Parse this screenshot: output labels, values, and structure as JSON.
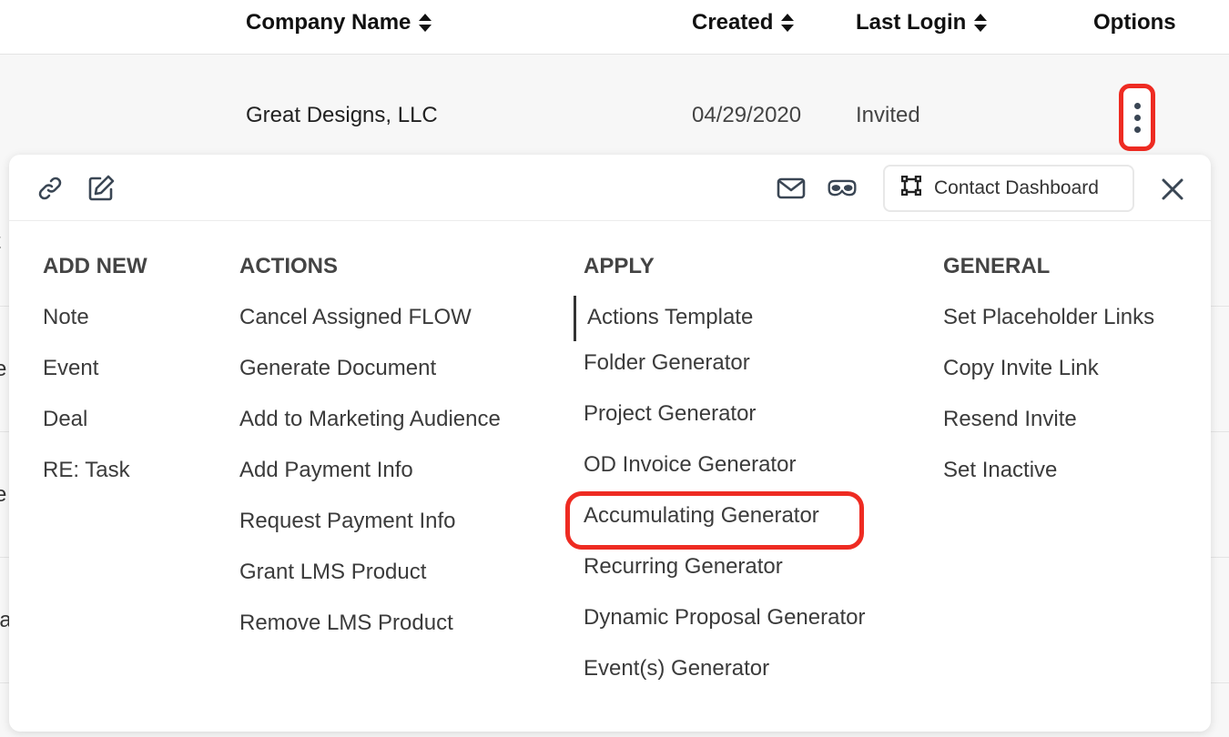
{
  "table": {
    "columns": [
      {
        "label": "Company Name"
      },
      {
        "label": "Created"
      },
      {
        "label": "Last Login"
      },
      {
        "label": "Options"
      }
    ],
    "row": {
      "company": "Great Designs, LLC",
      "created": "04/29/2020",
      "last_login": "Invited"
    }
  },
  "clipped_edge_chars": [
    "t",
    "e",
    "e",
    "la"
  ],
  "toolbar": {
    "contact_dashboard_label": "Contact Dashboard"
  },
  "menu": {
    "add_new": {
      "heading": "ADD NEW",
      "items": [
        "Note",
        "Event",
        "Deal",
        "RE: Task"
      ]
    },
    "actions": {
      "heading": "ACTIONS",
      "items": [
        "Cancel Assigned FLOW",
        "Generate Document",
        "Add to Marketing Audience",
        "Add Payment Info",
        "Request Payment Info",
        "Grant LMS Product",
        "Remove LMS Product"
      ]
    },
    "apply": {
      "heading": "APPLY",
      "items": [
        "Actions Template",
        "Folder Generator",
        "Project Generator",
        "OD Invoice Generator",
        "Accumulating Generator",
        "Recurring Generator",
        "Dynamic Proposal Generator",
        "Event(s) Generator"
      ]
    },
    "general": {
      "heading": "GENERAL",
      "items": [
        "Set Placeholder Links",
        "Copy Invite Link",
        "Resend Invite",
        "Set Inactive"
      ]
    }
  },
  "colors": {
    "highlight": "#ee2b22",
    "icon": "#3a4654"
  }
}
